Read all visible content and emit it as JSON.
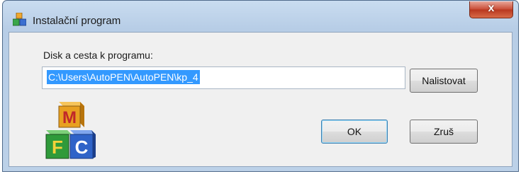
{
  "window": {
    "title": "Instalační program",
    "close_symbol": "x",
    "app_icon": "mfc-blocks-icon"
  },
  "form": {
    "path_label": "Disk a cesta k programu:",
    "path_value": "C:\\Users\\AutoPEN\\AutoPEN\\kp_4",
    "browse_label": "Nalistovat"
  },
  "buttons": {
    "ok_label": "OK",
    "cancel_label": "Zruš"
  },
  "logo": {
    "letters": [
      "M",
      "F",
      "C"
    ],
    "colors": {
      "m_block": "#e8a020",
      "f_block": "#2f9a3a",
      "c_block": "#2f63c8"
    }
  }
}
